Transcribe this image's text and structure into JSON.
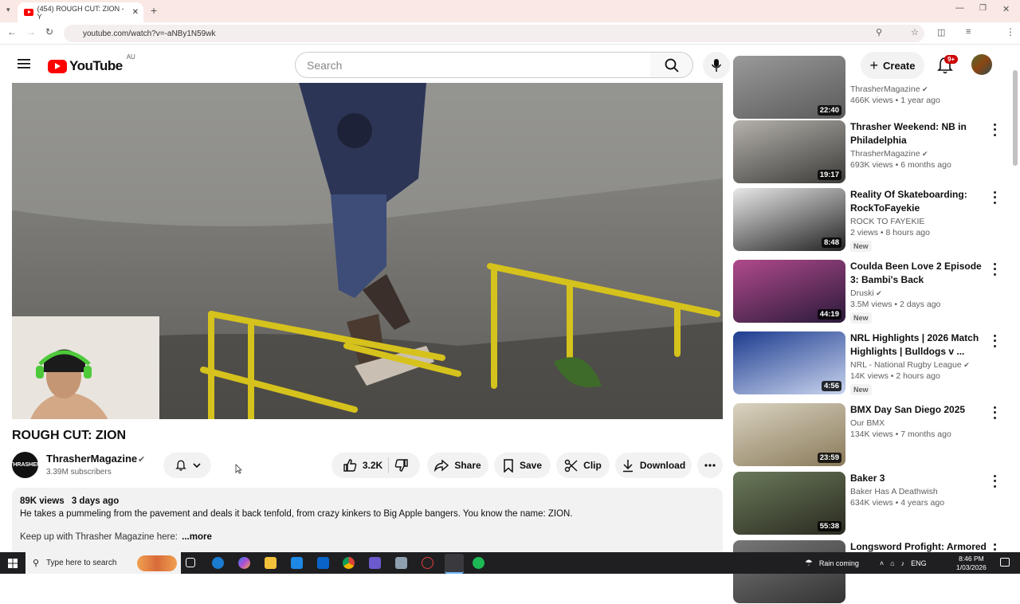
{
  "browser": {
    "tab_title": "(454) ROUGH CUT: ZION - Y",
    "url": "youtube.com/watch?v=-aNBy1N59wk"
  },
  "header": {
    "logo_text": "YouTube",
    "region": "AU",
    "search_placeholder": "Search",
    "create_label": "Create",
    "notif_count": "9+"
  },
  "video": {
    "title": "ROUGH CUT: ZION",
    "channel": "ThrasherMagazine",
    "channel_avatar_text": "THRASHER",
    "subscribers": "3.39M subscribers",
    "likes": "3.2K",
    "share_label": "Share",
    "save_label": "Save",
    "clip_label": "Clip",
    "download_label": "Download",
    "views": "89K views",
    "age": "3 days ago",
    "description_line1": "He takes a pummeling from the pavement and deals it back tenfold, from crazy kinkers to Big Apple bangers. You know the name: ZION.",
    "description_line2": "Keep up with Thrasher Magazine here:",
    "more_label": "...more"
  },
  "sidebar": [
    {
      "title": "",
      "channel": "ThrasherMagazine",
      "verified": true,
      "views": "466K views • 1 year ago",
      "duration": "22:40",
      "is_new": false,
      "thumb_colors": [
        "#9a9a9a",
        "#5a5a5a"
      ]
    },
    {
      "title": "Thrasher Weekend: NB in Philadelphia",
      "channel": "ThrasherMagazine",
      "verified": true,
      "views": "693K views • 6 months ago",
      "duration": "19:17",
      "is_new": false,
      "thumb_colors": [
        "#b5b2ad",
        "#3d3b38"
      ]
    },
    {
      "title": "Reality Of Skateboarding: RockToFayekie",
      "channel": "ROCK TO FAYEKIE",
      "verified": false,
      "views": "2 views • 8 hours ago",
      "duration": "8:48",
      "is_new": true,
      "thumb_colors": [
        "#e8e8e8",
        "#222222"
      ]
    },
    {
      "title": "Coulda Been Love 2 Episode 3: Bambi's Back",
      "channel": "Druski",
      "verified": true,
      "views": "3.5M views • 2 days ago",
      "duration": "44:19",
      "is_new": true,
      "thumb_colors": [
        "#b04a8a",
        "#2a1a3a"
      ]
    },
    {
      "title": "NRL Highlights | 2026 Match Highlights | Bulldogs v ...",
      "channel": "NRL - National Rugby League",
      "verified": true,
      "views": "14K views • 2 hours ago",
      "duration": "4:56",
      "is_new": true,
      "thumb_colors": [
        "#1d3c8f",
        "#c9d4ee"
      ]
    },
    {
      "title": "BMX Day San Diego 2025",
      "channel": "Our BMX",
      "verified": false,
      "views": "134K views • 7 months ago",
      "duration": "23:59",
      "is_new": false,
      "thumb_colors": [
        "#d9d3c0",
        "#8a7a5a"
      ]
    },
    {
      "title": "Baker 3",
      "channel": "Baker Has A Deathwish",
      "verified": false,
      "views": "634K views • 4 years ago",
      "duration": "55:38",
      "is_new": false,
      "thumb_colors": [
        "#6a7a5a",
        "#2a2a20"
      ]
    },
    {
      "title": "Longsword Profight: Armored",
      "channel": "",
      "verified": false,
      "views": "",
      "duration": "",
      "is_new": false,
      "thumb_colors": [
        "#777777",
        "#333333"
      ]
    }
  ],
  "new_badge": "New",
  "taskbar": {
    "search_placeholder": "Type here to search",
    "weather": "Rain coming",
    "lang": "ENG",
    "time": "8:46 PM",
    "date": "1/03/2026"
  }
}
